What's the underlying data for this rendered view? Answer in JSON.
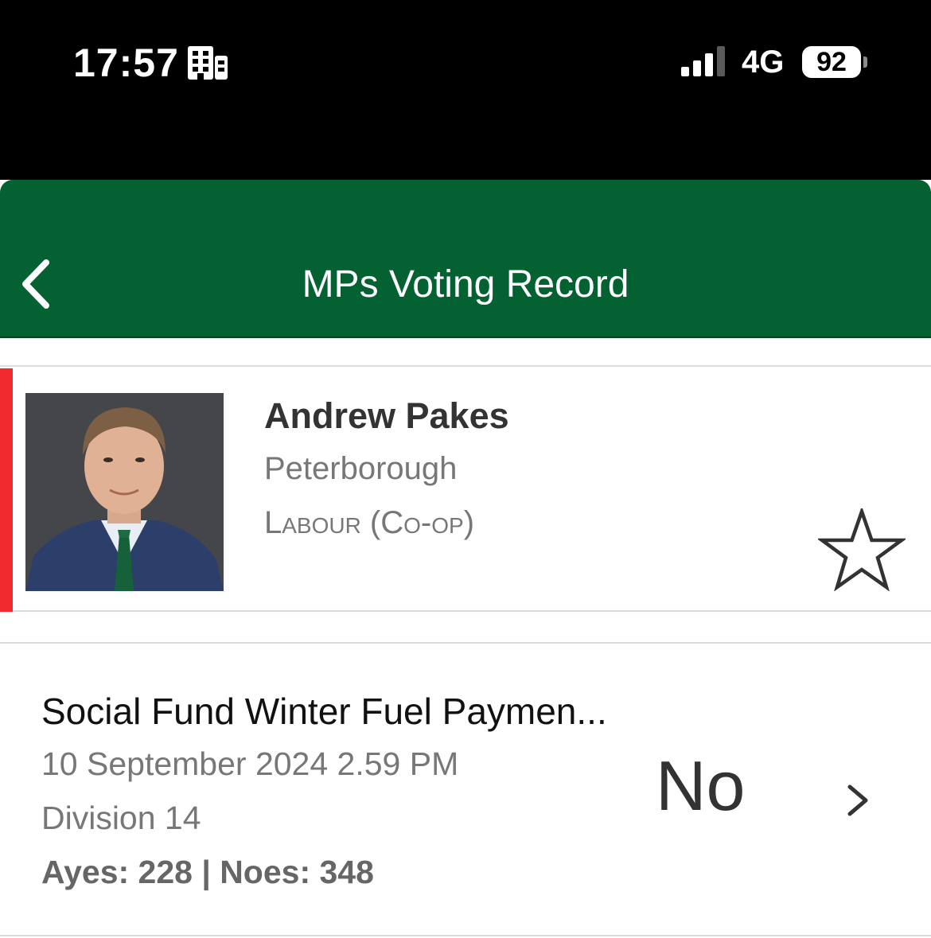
{
  "status_bar": {
    "time": "17:57",
    "network": "4G",
    "battery": "92",
    "icons": [
      "building-icon",
      "signal-icon",
      "battery-icon"
    ]
  },
  "nav": {
    "title": "MPs Voting Record",
    "back_icon": "chevron-left-icon"
  },
  "mp": {
    "name": "Andrew Pakes",
    "constituency": "Peterborough",
    "party": "Labour (Co-op)",
    "party_color": "#f02a2f",
    "favorite_icon": "star-outline-icon"
  },
  "vote": {
    "title": "Social Fund Winter Fuel Paymen...",
    "date": "10 September 2024 2.59 PM",
    "division": "Division 14",
    "tally": "Ayes: 228 | Noes: 348",
    "result": "No",
    "chevron_icon": "chevron-right-icon"
  },
  "colors": {
    "nav_green": "#046232",
    "status_bar": "#000000"
  }
}
